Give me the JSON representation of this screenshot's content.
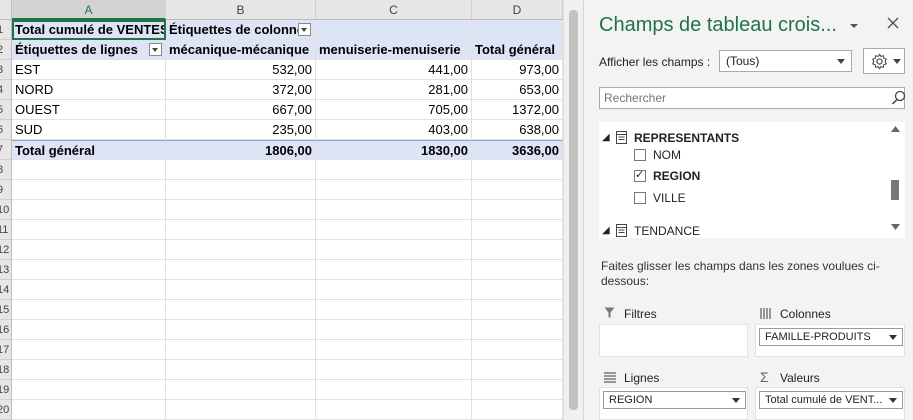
{
  "grid": {
    "columns": [
      "A",
      "B",
      "C",
      "D"
    ],
    "rows": [
      "1",
      "2",
      "3",
      "4",
      "5",
      "6",
      "7",
      "8",
      "9",
      "10",
      "11",
      "12",
      "13",
      "14",
      "15",
      "16",
      "17",
      "18",
      "19",
      "20"
    ],
    "r1": {
      "a": "Total cumulé de VENTES",
      "b": "Étiquettes de colonnes"
    },
    "r2": {
      "a": "Étiquettes de lignes",
      "b": "mécanique-mécanique",
      "c": "menuiserie-menuiserie",
      "d": "Total général"
    },
    "data": [
      {
        "label": "EST",
        "b": "532,00",
        "c": "441,00",
        "d": "973,00"
      },
      {
        "label": "NORD",
        "b": "372,00",
        "c": "281,00",
        "d": "653,00"
      },
      {
        "label": "OUEST",
        "b": "667,00",
        "c": "705,00",
        "d": "1372,00"
      },
      {
        "label": "SUD",
        "b": "235,00",
        "c": "403,00",
        "d": "638,00"
      }
    ],
    "total": {
      "label": "Total général",
      "b": "1806,00",
      "c": "1830,00",
      "d": "3636,00"
    }
  },
  "pane": {
    "title": "Champs de tableau crois...",
    "show_fields_label": "Afficher les champs :",
    "show_fields_value": "(Tous)",
    "search_placeholder": "Rechercher",
    "tables": [
      {
        "name": "REPRESENTANTS",
        "fields": [
          {
            "name": "NOM",
            "checked": false
          },
          {
            "name": "REGION",
            "checked": true
          },
          {
            "name": "VILLE",
            "checked": false
          }
        ]
      },
      {
        "name": "TENDANCE",
        "fields": []
      }
    ],
    "drag_text": "Faites glisser les champs dans les zones voulues ci-dessous:",
    "areas": {
      "filters": {
        "title": "Filtres"
      },
      "columns": {
        "title": "Colonnes",
        "item": "FAMILLE-PRODUITS"
      },
      "rows": {
        "title": "Lignes",
        "item": "REGION"
      },
      "values": {
        "title": "Valeurs",
        "item": "Total cumulé de VENT..."
      }
    }
  },
  "colors": {
    "accent": "#217346",
    "pivot_header": "#dde4f5"
  }
}
